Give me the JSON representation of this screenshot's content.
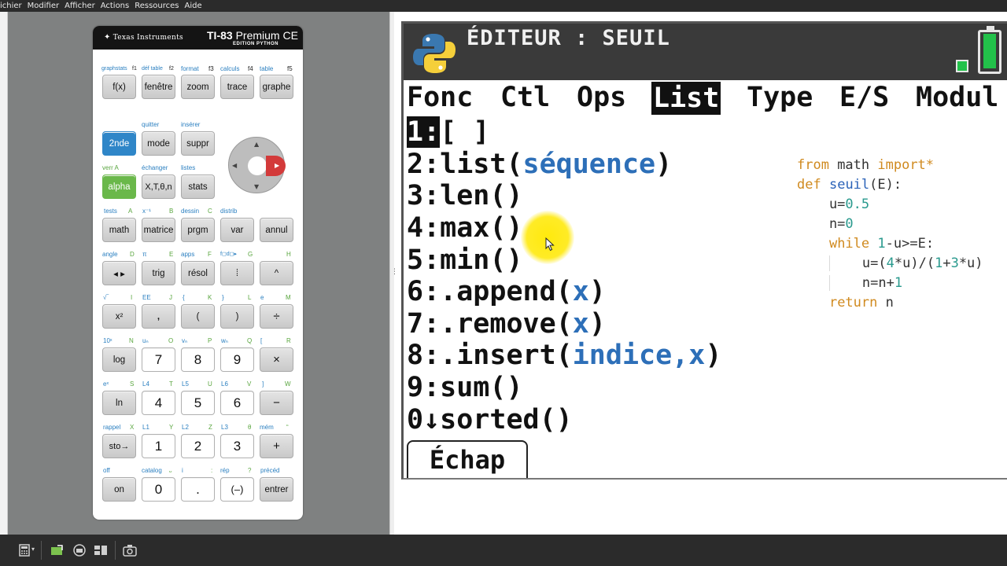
{
  "menubar": {
    "items": [
      "ichier",
      "Modifier",
      "Afficher",
      "Actions",
      "Ressources",
      "Aide"
    ]
  },
  "calculator": {
    "brand": "Texas Instruments",
    "model": "TI-83",
    "model_suffix": "Premium CE",
    "edition": "EDITION PYTHON",
    "f_labels": [
      {
        "text": "graphstats",
        "f": "f1"
      },
      {
        "text": "déf table",
        "f": "f2"
      },
      {
        "text": "format",
        "f": "f3"
      },
      {
        "text": "calculs",
        "f": "f4"
      },
      {
        "text": "table",
        "f": "f5"
      }
    ],
    "keys": {
      "row1": [
        "f(x)",
        "fenêtre",
        "zoom",
        "trace",
        "graphe"
      ],
      "row2": [
        "2nde",
        "mode",
        "suppr"
      ],
      "row2_labels": [
        "quitter",
        "insérer"
      ],
      "row3": [
        "alpha",
        "X,T,θ,n",
        "stats"
      ],
      "row3_labels": [
        "verr A",
        "échanger",
        "listes"
      ],
      "row4": [
        "math",
        "matrice",
        "prgm",
        "var",
        "annul"
      ],
      "row4_labels": [
        "tests",
        "A",
        "x⁻¹",
        "B",
        "dessin",
        "C",
        "distrib"
      ],
      "row5": [
        "◂ ▸",
        "trig",
        "résol",
        "⁞",
        "^"
      ],
      "row5_labels": [
        "angle",
        "D",
        "π",
        "E",
        "apps",
        "F",
        "f◻d◻▸",
        "G",
        "H"
      ],
      "row6": [
        "x²",
        ",",
        "(",
        ")",
        "÷"
      ],
      "row6_labels": [
        "√‾",
        "I",
        "EE",
        "J",
        "{",
        "K",
        "}",
        "L",
        "e",
        "M"
      ],
      "row7": [
        "log",
        "7",
        "8",
        "9",
        "×"
      ],
      "row7_labels": [
        "10ˣ",
        "N",
        "uₙ",
        "O",
        "vₙ",
        "P",
        "wₙ",
        "Q",
        "[",
        "R"
      ],
      "row8": [
        "ln",
        "4",
        "5",
        "6",
        "−"
      ],
      "row8_labels": [
        "eˣ",
        "S",
        "L4",
        "T",
        "L5",
        "U",
        "L6",
        "V",
        "]",
        "W"
      ],
      "row9": [
        "sto→",
        "1",
        "2",
        "3",
        "+"
      ],
      "row9_labels": [
        "rappel",
        "X",
        "L1",
        "Y",
        "L2",
        "Z",
        "L3",
        "θ",
        "mém",
        "“"
      ],
      "row10": [
        "on",
        "0",
        ".",
        "(–)",
        "entrer"
      ],
      "row10_labels": [
        "off",
        "catalog",
        "⎵",
        "i",
        ":",
        "rép",
        "?",
        "précéd"
      ]
    }
  },
  "screen": {
    "title": "ÉDITEUR : SEUIL",
    "tabs": [
      "Fonc",
      "Ctl",
      "Ops",
      "List",
      "Type",
      "E/S",
      "Modul"
    ],
    "active_tab": "List",
    "menu": [
      {
        "num": "1:",
        "text": "[ ]",
        "arg": "",
        "close": "",
        "selected": true
      },
      {
        "num": "2:",
        "text": "list(",
        "arg": "séquence",
        "close": ")"
      },
      {
        "num": "3:",
        "text": "len()",
        "arg": "",
        "close": ""
      },
      {
        "num": "4:",
        "text": "max()",
        "arg": "",
        "close": ""
      },
      {
        "num": "5:",
        "text": "min()",
        "arg": "",
        "close": ""
      },
      {
        "num": "6:",
        "text": ".append(",
        "arg": "x",
        "close": ")"
      },
      {
        "num": "7:",
        "text": ".remove(",
        "arg": "x",
        "close": ")"
      },
      {
        "num": "8:",
        "text": ".insert(",
        "arg": "indice,x",
        "close": ")"
      },
      {
        "num": "9:",
        "text": "sum()",
        "arg": "",
        "close": ""
      },
      {
        "num": "0↓",
        "text": "sorted()",
        "arg": "",
        "close": ""
      }
    ],
    "escape_button": "Échap",
    "code_lines": [
      "from math import*",
      "def seuil(E):",
      "    u=0.5",
      "    n=0",
      "    while 1-u>=E:",
      "        u=(4*u)/(1+3*u)",
      "        n=n+1",
      "    return n"
    ]
  },
  "colors": {
    "key_blue": "#2f86c8",
    "key_green": "#6ab84a",
    "label_blue": "#2a7fc0",
    "arg_blue": "#2d6fb8",
    "keyword_orange": "#d08a1f",
    "number_teal": "#2a9a8e",
    "battery_green": "#22c14a"
  },
  "icons": [
    "python-logo-icon",
    "battery-icon",
    "mouse-cursor-icon",
    "calculator-icon",
    "screenshot-camera-icon"
  ]
}
